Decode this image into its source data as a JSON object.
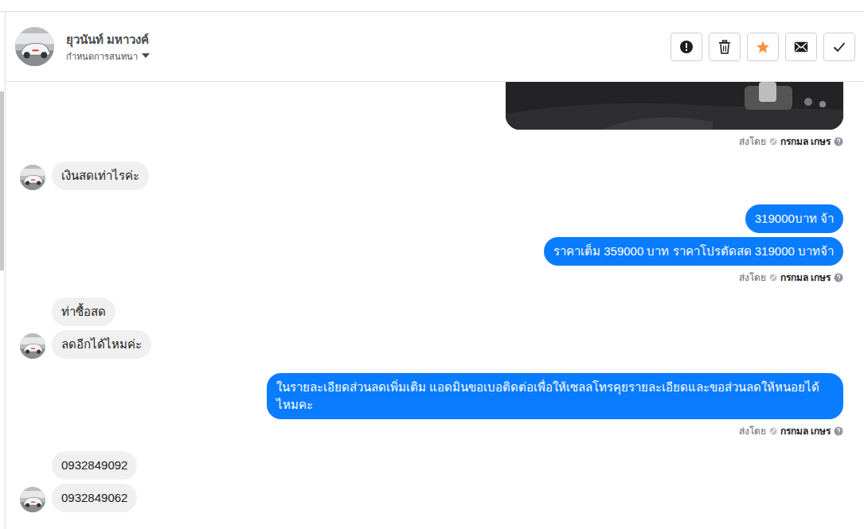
{
  "header": {
    "name": "ยุวนันท์ มหาวงค์",
    "subtitle": "กำหนดการสนทนา"
  },
  "buttons": [
    {
      "kind": "report",
      "on": false
    },
    {
      "kind": "delete",
      "on": false
    },
    {
      "kind": "star",
      "on": true
    },
    {
      "kind": "mail",
      "on": false
    },
    {
      "kind": "done",
      "on": false
    }
  ],
  "messages": [
    {
      "kind": "outgoing",
      "items": [
        {
          "kind": "image",
          "text": ""
        }
      ],
      "sent_by": {
        "label": "ส่งโดย",
        "name": "กรกมล เกษร"
      }
    },
    {
      "kind": "incoming",
      "items": [
        {
          "kind": "text",
          "text": "เงินสดเท่าไรค่ะ"
        }
      ]
    },
    {
      "kind": "outgoing",
      "items": [
        {
          "kind": "text",
          "text": "319000บาท จ้า"
        },
        {
          "kind": "text",
          "text": "ราคาเต็ม 359000 บาท ราคาโปรตัดสด 319000 บาทจ้า"
        }
      ],
      "sent_by": {
        "label": "ส่งโดย",
        "name": "กรกมล เกษร"
      }
    },
    {
      "kind": "incoming",
      "items": [
        {
          "kind": "text",
          "text": "ท่าซื้อสด"
        },
        {
          "kind": "text",
          "text": "ลดอีกได้ไหมค่ะ"
        }
      ]
    },
    {
      "kind": "outgoing",
      "items": [
        {
          "kind": "text",
          "text": "ในรายละเอียดส่วนลดเพิ่มเติม แอดมินขอเบอติดต่อเพื่อให้เซลลโทรคุยรายละเอียดและขอส่วนลดให้หนอยได้ไหมคะ"
        }
      ],
      "sent_by": {
        "label": "ส่งโดย",
        "name": "กรกมล เกษร"
      }
    },
    {
      "kind": "incoming",
      "items": [
        {
          "kind": "text",
          "text": "0932849092"
        },
        {
          "kind": "text",
          "text": "0932849062"
        }
      ]
    }
  ]
}
